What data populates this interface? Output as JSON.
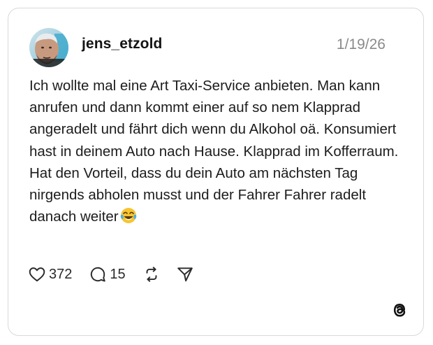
{
  "post": {
    "author": {
      "username": "jens_etzold",
      "avatar_icon": "avatar-photo"
    },
    "date": "1/19/26",
    "text": "Ich wollte mal eine Art Taxi-Service anbieten. Man kann anrufen und dann kommt einer auf so nem Klapprad angeradelt und fährt dich wenn du Alkohol oä. Konsumiert hast in deinem Auto nach Hause.  Klapprad im Kofferraum.\nHat den Vorteil, dass du dein Auto am nächsten Tag nirgends abholen musst und der Fahrer Fahrer radelt danach weiter",
    "emoji_icon": "face-with-tears-of-joy-emoji",
    "stats": {
      "likes": "372",
      "replies": "15"
    }
  },
  "icons": {
    "like": "heart-icon",
    "reply": "comment-bubble-icon",
    "repost": "repost-icon",
    "share": "send-icon",
    "brand": "threads-logo"
  },
  "colors": {
    "text": "#1c1c1c",
    "muted": "#8a8a8a",
    "border": "#d9d9d9",
    "emoji": "#f7c531"
  }
}
